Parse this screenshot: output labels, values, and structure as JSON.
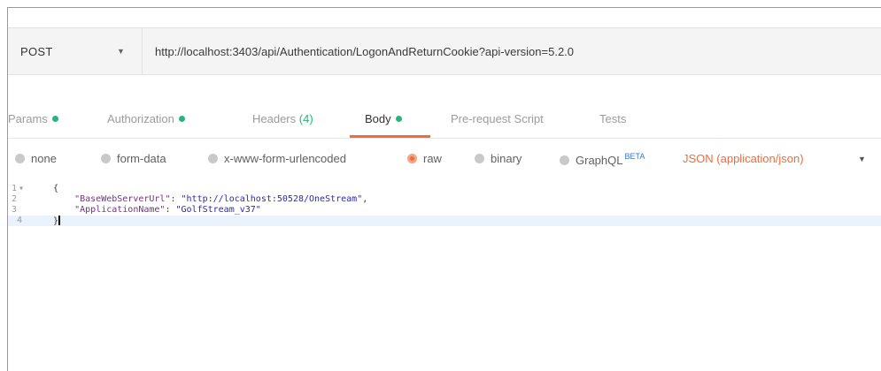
{
  "request": {
    "method": "POST",
    "method_caret_icon": "caret-down-icon",
    "url": "http://localhost:3403/api/Authentication/LogonAndReturnCookie?api-version=5.2.0"
  },
  "tabs": [
    {
      "label": "Params",
      "dot": true,
      "count": ""
    },
    {
      "label": "Authorization",
      "dot": true,
      "count": ""
    },
    {
      "label": "Headers",
      "dot": false,
      "count": "(4)"
    },
    {
      "label": "Body",
      "dot": true,
      "count": "",
      "active": true
    },
    {
      "label": "Pre-request Script",
      "dot": false,
      "count": ""
    },
    {
      "label": "Tests",
      "dot": false,
      "count": ""
    }
  ],
  "body_options": {
    "none": "none",
    "form_data": "form-data",
    "urlencoded": "x-www-form-urlencoded",
    "raw": "raw",
    "binary": "binary",
    "graphql": "GraphQL",
    "graphql_badge": "BETA",
    "selected": "raw",
    "content_type": "JSON (application/json)"
  },
  "editor": {
    "line_numbers": [
      "1",
      "2",
      "3",
      "4"
    ],
    "line1": "{",
    "key1": "\"BaseWebServerUrl\"",
    "val1": "\"http://localhost:50528/OneStream\"",
    "key2": "\"ApplicationName\"",
    "val2": "\"GolfStream_v37\"",
    "line4": "}"
  },
  "colors": {
    "accent": "#f26b3a",
    "status_dot": "#26b47f",
    "beta": "#2a7ae4"
  }
}
